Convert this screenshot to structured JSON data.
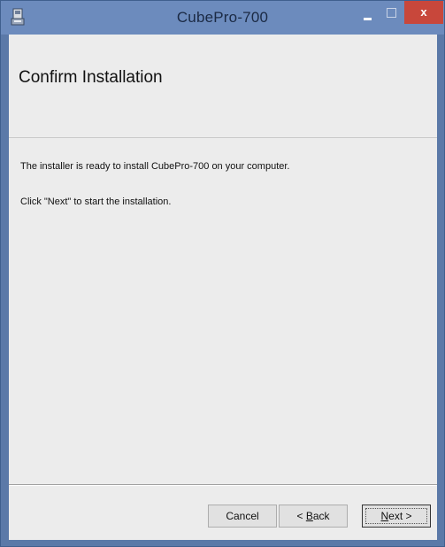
{
  "window": {
    "title": "CubePro-700",
    "close_glyph": "x",
    "app_icon": "installer-icon",
    "minimize_icon": "minimize-icon",
    "maximize_icon": "maximize-icon",
    "close_icon": "close-icon",
    "colors": {
      "titlebar": "#6c8bbd",
      "frame": "#5b79a8",
      "close": "#c8473b",
      "client": "#ececec"
    }
  },
  "page": {
    "title": "Confirm Installation",
    "line1": "The installer is ready to install CubePro-700 on your computer.",
    "line2": "Click \"Next\" to start the installation."
  },
  "buttons": {
    "cancel": "Cancel",
    "back_prefix": "< ",
    "back_accel": "B",
    "back_rest": "ack",
    "next_accel": "N",
    "next_rest": "ext >"
  }
}
